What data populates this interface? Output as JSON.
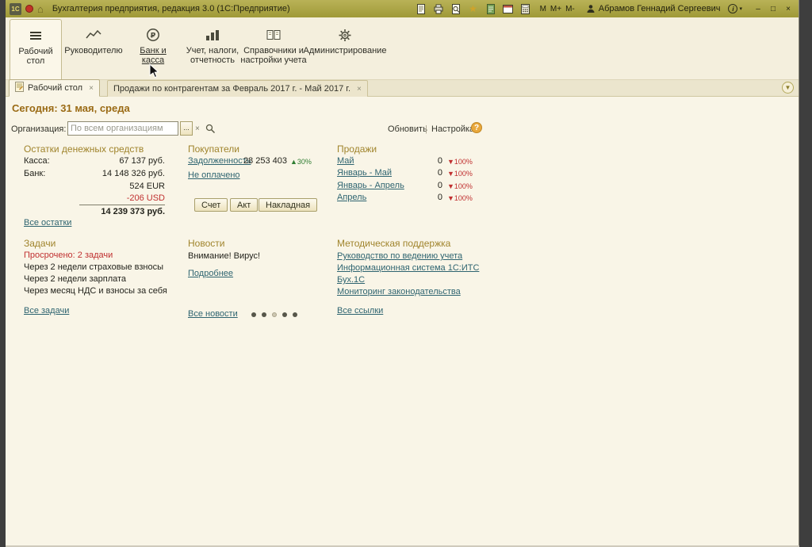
{
  "window": {
    "app_badge": "1С",
    "title": "Бухгалтерия предприятия, редакция 3.0  (1С:Предприятие)",
    "user": "Абрамов Геннадий Сергеевич",
    "memory_buttons": [
      "M",
      "M+",
      "M-"
    ],
    "controls": {
      "minimize": "–",
      "maximize": "□",
      "close": "×"
    }
  },
  "colors": {
    "titlebar": "#aaa444",
    "link": "#2e6470",
    "section_header": "#a0842c",
    "negative": "#c03030",
    "positive": "#2f7d32"
  },
  "sections": [
    {
      "label": "Рабочий стол",
      "active": true
    },
    {
      "label": "Руководителю",
      "active": false
    },
    {
      "label": "Банк и касса",
      "active": false
    },
    {
      "label": "Учет, налоги, отчетность",
      "active": false
    },
    {
      "label": "Справочники и настройки учета",
      "active": false
    },
    {
      "label": "Администрирование",
      "active": false
    }
  ],
  "tabs": [
    {
      "label": "Рабочий стол",
      "active": true
    },
    {
      "label": "Продажи по контрагентам за Февраль 2017 г. - Май 2017 г.",
      "active": false
    }
  ],
  "desktop": {
    "today": "Сегодня: 31 мая, среда",
    "org_label": "Организация:",
    "org_placeholder": "По всем организациям",
    "org_more": "...",
    "refresh": "Обновить",
    "settings": "Настройка",
    "help_label": "?",
    "cash": {
      "title": "Остатки денежных средств",
      "rows": [
        {
          "label": "Касса:",
          "value": "67 137 руб."
        },
        {
          "label": "Банк:",
          "value": "14 148 326 руб."
        },
        {
          "label": "",
          "value": "524 EUR"
        },
        {
          "label": "",
          "value": "-206 USD"
        }
      ],
      "total": "14 239 373 руб.",
      "all_link": "Все остатки"
    },
    "buyers": {
      "title": "Покупатели",
      "debt_link": "Задолженность",
      "debt_value": "28 253 403",
      "debt_trend": "▲30%",
      "unpaid_link": "Не оплачено",
      "buttons": [
        "Счет",
        "Акт",
        "Накладная"
      ]
    },
    "sales": {
      "title": "Продажи",
      "rows": [
        {
          "label": "Май",
          "value": "0",
          "trend": "▼100%"
        },
        {
          "label": "Январь - Май",
          "value": "0",
          "trend": "▼100%"
        },
        {
          "label": "Январь - Апрель",
          "value": "0",
          "trend": "▼100%"
        },
        {
          "label": "Апрель",
          "value": "0",
          "trend": "▼100%"
        }
      ]
    },
    "tasks": {
      "title": "Задачи",
      "overdue": "Просрочено: 2 задачи",
      "items": [
        "Через 2 недели страховые взносы",
        "Через 2 недели зарплата",
        "Через месяц НДС и взносы за себя"
      ],
      "all_link": "Все задачи"
    },
    "news": {
      "title": "Новости",
      "headline": "Внимание! Вирус!",
      "more_link": "Подробнее",
      "all_link": "Все новости"
    },
    "support": {
      "title": "Методическая поддержка",
      "links": [
        "Руководство по ведению учета",
        "Информационная система 1С:ИТС",
        "Бух.1С",
        "Мониторинг законодательства"
      ],
      "all_link": "Все ссылки"
    }
  }
}
